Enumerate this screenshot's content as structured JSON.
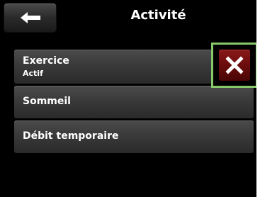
{
  "header": {
    "title": "Activité",
    "back_icon": "arrow-left-icon"
  },
  "menu": {
    "items": [
      {
        "label": "Exercice",
        "sublabel": "Actif"
      },
      {
        "label": "Sommeil"
      },
      {
        "label": "Débit temporaire"
      }
    ]
  },
  "cancel": {
    "icon": "close-icon",
    "accent_color": "#6b0c0c",
    "highlight_color": "#86c86a"
  }
}
